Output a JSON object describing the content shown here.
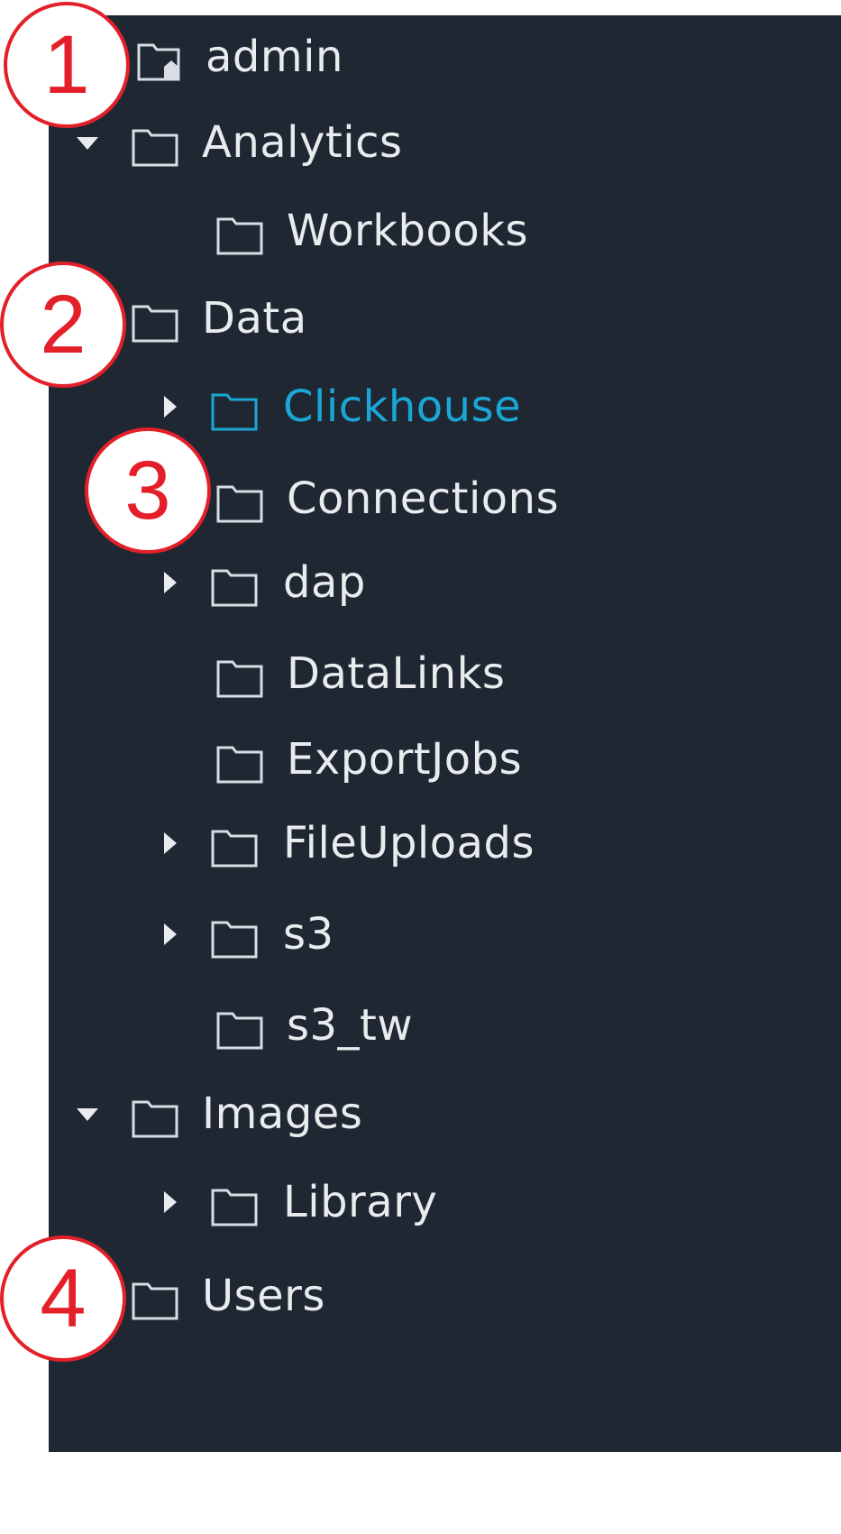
{
  "colors": {
    "panel_bg": "#1f2733",
    "text": "#e9ecef",
    "active": "#1ba7d6",
    "callout": "#e3202a"
  },
  "tree": [
    {
      "label": "admin",
      "icon": "home-folder-icon",
      "caret": "none"
    },
    {
      "label": "Analytics",
      "icon": "folder-icon",
      "caret": "expanded"
    },
    {
      "label": "Workbooks",
      "icon": "folder-icon",
      "caret": "none"
    },
    {
      "label": "Data",
      "icon": "folder-icon",
      "caret": "none"
    },
    {
      "label": "Clickhouse",
      "icon": "folder-icon",
      "caret": "collapsed",
      "active": true
    },
    {
      "label": "Connections",
      "icon": "folder-icon",
      "caret": "none"
    },
    {
      "label": "dap",
      "icon": "folder-icon",
      "caret": "collapsed"
    },
    {
      "label": "DataLinks",
      "icon": "folder-icon",
      "caret": "none"
    },
    {
      "label": "ExportJobs",
      "icon": "folder-icon",
      "caret": "none"
    },
    {
      "label": "FileUploads",
      "icon": "folder-icon",
      "caret": "collapsed"
    },
    {
      "label": "s3",
      "icon": "folder-icon",
      "caret": "collapsed"
    },
    {
      "label": "s3_tw",
      "icon": "folder-icon",
      "caret": "none"
    },
    {
      "label": "Images",
      "icon": "folder-icon",
      "caret": "expanded"
    },
    {
      "label": "Library",
      "icon": "folder-icon",
      "caret": "collapsed"
    },
    {
      "label": "Users",
      "icon": "folder-icon",
      "caret": "none"
    }
  ],
  "callouts": [
    "1",
    "2",
    "3",
    "4"
  ]
}
